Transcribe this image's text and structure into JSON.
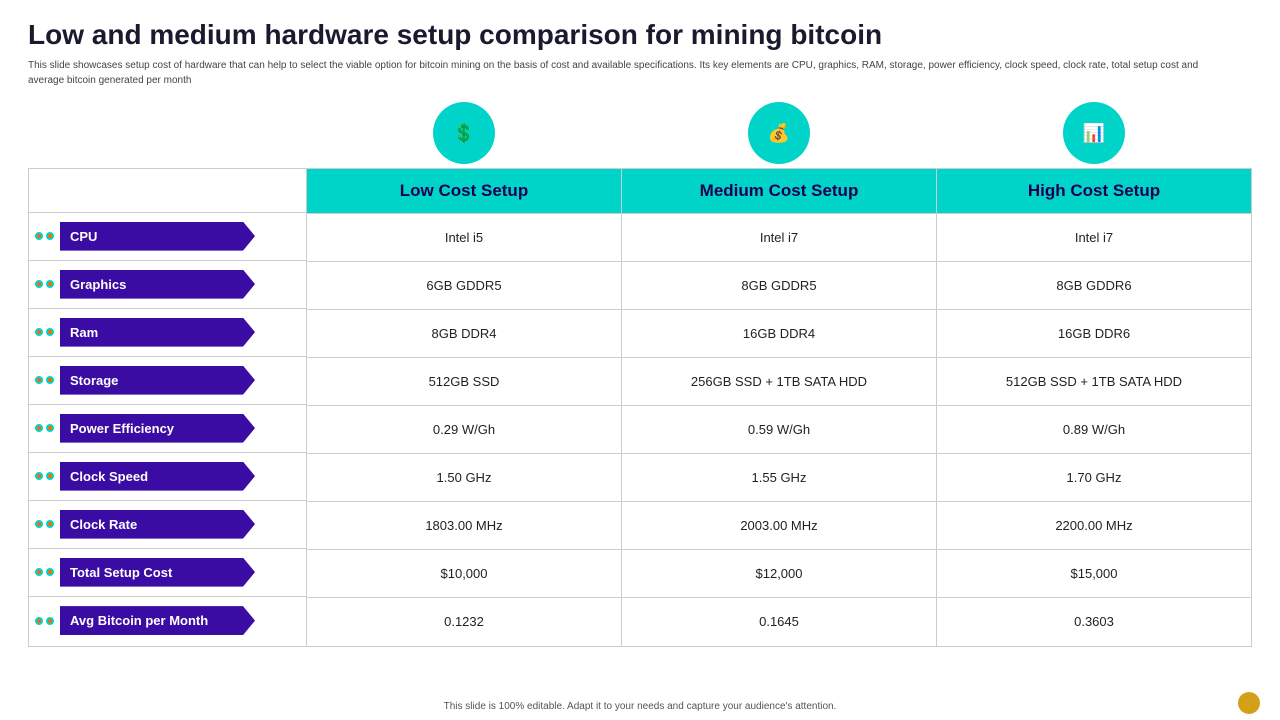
{
  "title": "Low and medium hardware setup comparison for mining bitcoin",
  "subtitle": "This slide showcases setup cost of hardware that can help to select the viable option for bitcoin mining on the basis of cost and available specifications. Its key elements are CPU, graphics, RAM, storage, power efficiency, clock speed, clock rate, total setup cost and average bitcoin generated per month",
  "footer": "This slide is 100% editable. Adapt it to your needs and capture your audience's attention.",
  "icons": [
    {
      "symbol": "💲",
      "label": "Low Cost Setup"
    },
    {
      "symbol": "💰",
      "label": "Medium Cost Setup"
    },
    {
      "symbol": "📊",
      "label": "High Cost Setup"
    }
  ],
  "columns": [
    "Low Cost Setup",
    "Medium Cost Setup",
    "High Cost Setup"
  ],
  "rows": [
    {
      "label": "CPU",
      "values": [
        "Intel i5",
        "Intel i7",
        "Intel i7"
      ]
    },
    {
      "label": "Graphics",
      "values": [
        "6GB GDDR5",
        "8GB GDDR5",
        "8GB GDDR6"
      ]
    },
    {
      "label": "Ram",
      "values": [
        "8GB DDR4",
        "16GB DDR4",
        "16GB DDR6"
      ]
    },
    {
      "label": "Storage",
      "values": [
        "512GB SSD",
        "256GB SSD + 1TB SATA  HDD",
        "512GB SSD + 1TB SATA  HDD"
      ]
    },
    {
      "label": "Power Efficiency",
      "values": [
        "0.29 W/Gh",
        "0.59 W/Gh",
        "0.89 W/Gh"
      ]
    },
    {
      "label": "Clock Speed",
      "values": [
        "1.50 GHz",
        "1.55 GHz",
        "1.70 GHz"
      ]
    },
    {
      "label": "Clock Rate",
      "values": [
        "1803.00 MHz",
        "2003.00 MHz",
        "2200.00 MHz"
      ]
    },
    {
      "label": "Total Setup Cost",
      "values": [
        "$10,000",
        "$12,000",
        "$15,000"
      ]
    },
    {
      "label": "Avg Bitcoin per Month",
      "values": [
        "0.1232",
        "0.1645",
        "0.3603"
      ]
    }
  ]
}
